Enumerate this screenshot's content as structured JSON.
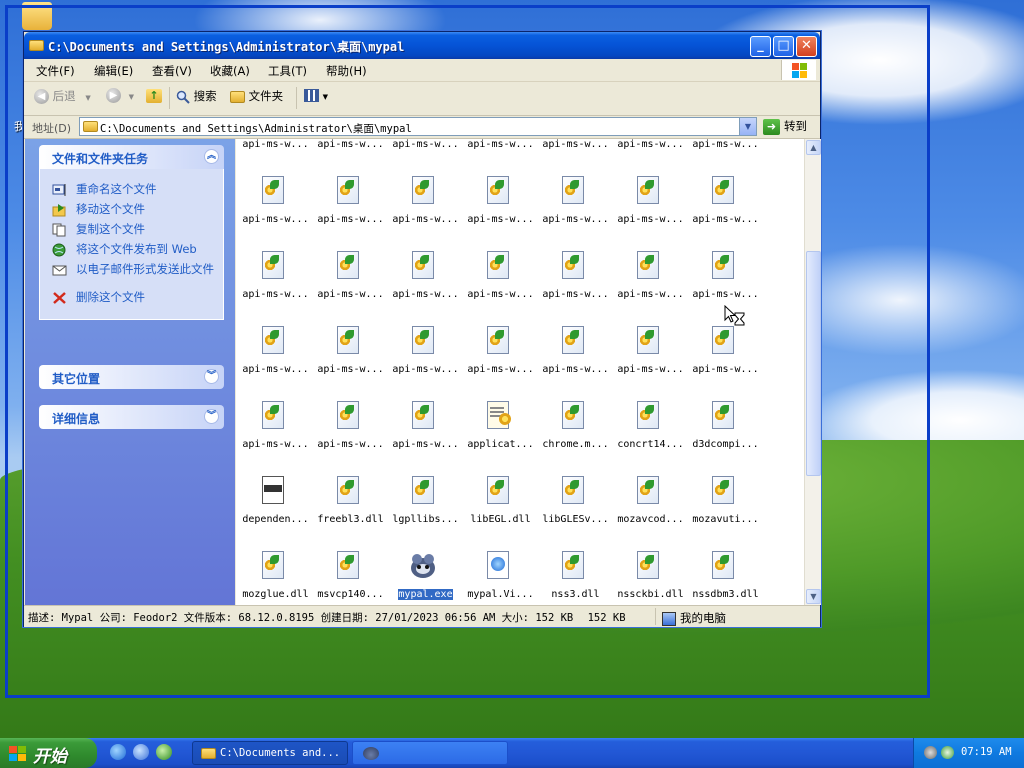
{
  "window": {
    "title": "C:\\Documents and Settings\\Administrator\\桌面\\mypal",
    "caption_minimize": "_",
    "caption_maximize": "□",
    "caption_close": "✕"
  },
  "menu": [
    "文件(F)",
    "编辑(E)",
    "查看(V)",
    "收藏(A)",
    "工具(T)",
    "帮助(H)"
  ],
  "toolbar": {
    "back": "后退",
    "search": "搜索",
    "folders": "文件夹"
  },
  "address": {
    "label": "地址(D)",
    "value": "C:\\Documents and Settings\\Administrator\\桌面\\mypal",
    "go": "转到"
  },
  "taskpane": {
    "file_tasks_title": "文件和文件夹任务",
    "tasks": [
      "重命名这个文件",
      "移动这个文件",
      "复制这个文件",
      "将这个文件发布到 Web",
      "以电子邮件形式发送此文件",
      "删除这个文件"
    ],
    "other_places_title": "其它位置",
    "details_title": "详细信息"
  },
  "files": {
    "rows": [
      [
        "api-ms-w...",
        "api-ms-w...",
        "api-ms-w...",
        "api-ms-w...",
        "api-ms-w...",
        "api-ms-w...",
        "api-ms-w..."
      ],
      [
        "api-ms-w...",
        "api-ms-w...",
        "api-ms-w...",
        "api-ms-w...",
        "api-ms-w...",
        "api-ms-w...",
        "api-ms-w..."
      ],
      [
        "api-ms-w...",
        "api-ms-w...",
        "api-ms-w...",
        "api-ms-w...",
        "api-ms-w...",
        "api-ms-w...",
        "api-ms-w..."
      ],
      [
        "api-ms-w...",
        "api-ms-w...",
        "api-ms-w...",
        "api-ms-w...",
        "api-ms-w...",
        "api-ms-w...",
        "api-ms-w..."
      ],
      [
        "api-ms-w...",
        "api-ms-w...",
        "api-ms-w...",
        "applicat...",
        "chrome.m...",
        "concrt14...",
        "d3dcompi..."
      ],
      [
        "dependen...",
        "freebl3.dll",
        "lgpllibs...",
        "libEGL.dll",
        "libGLESv...",
        "mozavcod...",
        "mozavuti..."
      ],
      [
        "mozglue.dll",
        "msvcp140...",
        "mypal.exe",
        "mypal.Vi...",
        "nss3.dll",
        "nssckbi.dll",
        "nssdbm3.dll"
      ]
    ],
    "selected": "mypal.exe"
  },
  "status": {
    "info": "描述: Mypal 公司: Feodor2 文件版本: 68.12.0.8195 创建日期: 27/01/2023 06:56 AM 大小: 152 KB",
    "size": "152 KB",
    "zone": "我的电脑"
  },
  "taskbar": {
    "start": "开始",
    "window_button": "C:\\Documents and...",
    "clock": "07:19 AM"
  },
  "colors": {
    "titlebar": "#0553d6",
    "taskpane": "#6f8ee0",
    "selection": "#316ac5",
    "start_green": "#3b9b39"
  }
}
